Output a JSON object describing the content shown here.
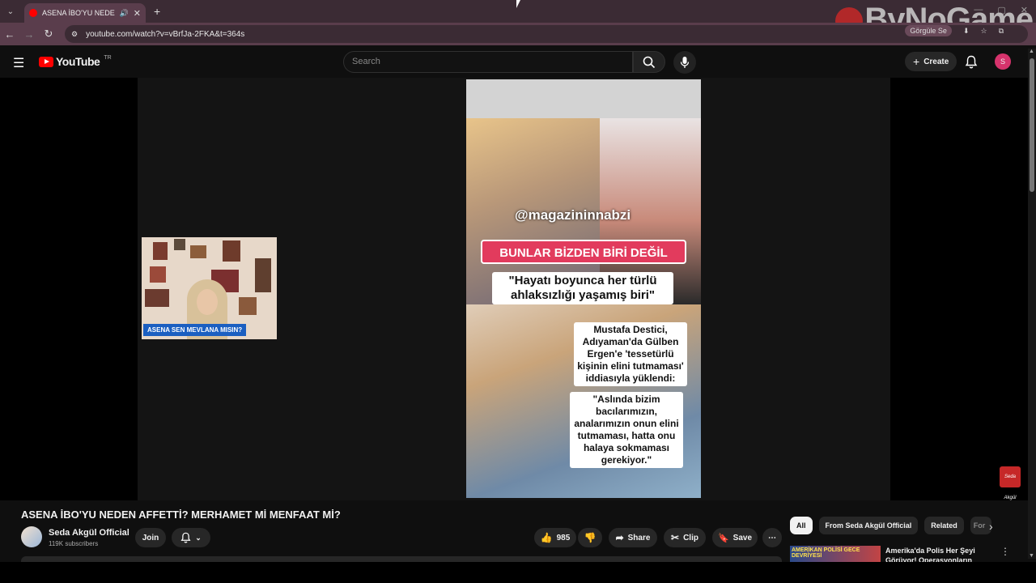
{
  "browser": {
    "tab_title": "ASENA İBO'YU NEDEN AFFETTİ",
    "tab_close": "✕",
    "new_tab": "+",
    "url": "youtube.com/watch?v=vBrfJa-2FKA&t=364s",
    "google_chip": "Görgüle Se",
    "watermark": "ByNoGame"
  },
  "header": {
    "logo_text": "YouTube",
    "country_code": "TR",
    "search_placeholder": "Search",
    "create_label": "Create",
    "avatar_letter": "S"
  },
  "player": {
    "pip_caption": "ASENA SEN MEVLANA MISIN?",
    "video_handle": "@magazininnabzi",
    "video_banner": "BUNLAR BİZDEN BİRİ DEĞİL",
    "video_quote": "\"Hayatı boyunca her türlü ahlaksızlığı yaşamış biri\"",
    "video_box1": "Mustafa Destici, Adıyaman'da Gülben Ergen'e 'tessetürlü kişinin elini tutmaması' iddiasıyla yüklendi:",
    "video_box2": "\"Aslında bizim bacılarımızın, analarımızın onun elini tutmaması, hatta onu halaya sokmaması gerekiyor.\"",
    "corner_logo": "Seda Akgül"
  },
  "video": {
    "title": "ASENA İBO'YU NEDEN AFFETTİ? MERHAMET Mİ MENFAAT Mİ?",
    "channel_name": "Seda Akgül Official",
    "subscribers": "119K subscribers",
    "join_label": "Join",
    "like_count": "985",
    "share_label": "Share",
    "clip_label": "Clip",
    "save_label": "Save"
  },
  "sidebar": {
    "chips": [
      "All",
      "From Seda Akgül Official",
      "Related",
      "For"
    ],
    "rec_thumb_text": "AMERİKAN POLİSİ GECE DEVRİYESİ",
    "rec_title": "Amerika'da Polis Her Şeyi Görüyor! Operasyonların Perde"
  },
  "colors": {
    "accent": "#ff0000",
    "avatar": "#d6336c",
    "banner": "#e23b5d",
    "tabbar": "#3b2b34"
  }
}
